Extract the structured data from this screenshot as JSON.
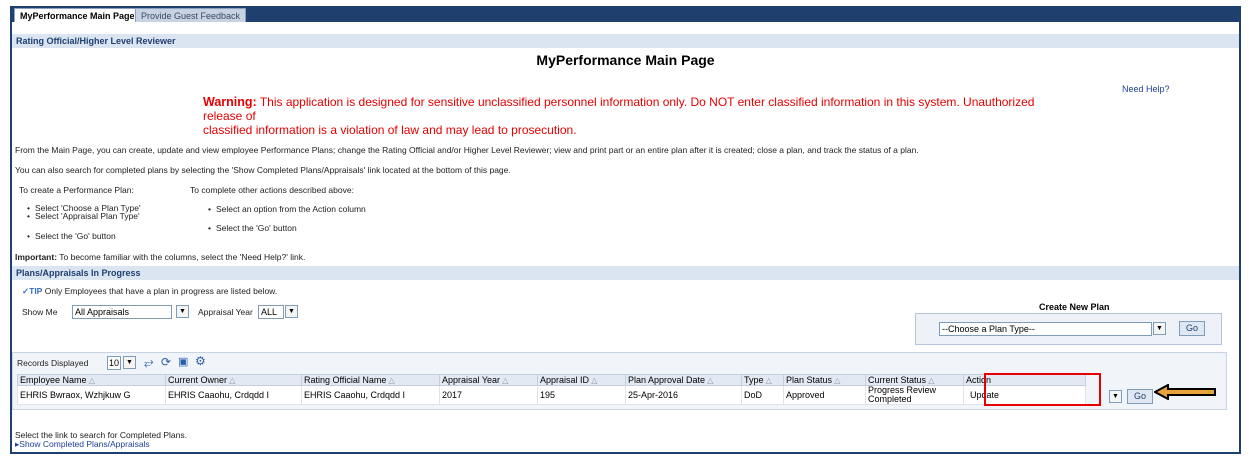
{
  "tabs": [
    {
      "label": "MyPerformance Main Page",
      "active": true
    },
    {
      "label": "Provide Guest Feedback",
      "active": false
    }
  ],
  "role_header": "Rating Official/Higher Level Reviewer",
  "page_title": "MyPerformance Main Page",
  "need_help": "Need Help?",
  "warning": {
    "label": "Warning:",
    "line1": "This application is designed for sensitive unclassified personnel information only. Do NOT enter classified information in this system. Unauthorized release of",
    "line2": "classified information is a violation of law and may lead to prosecution."
  },
  "intro": {
    "p1": "From the Main Page, you can create, update and view employee Performance Plans; change the Rating Official and/or Higher Level Reviewer; view and print part or an entire plan after it is created; close a plan, and track the status of a plan.",
    "p2": "You can also search for completed plans by selecting the 'Show Completed Plans/Appraisals' link located at the bottom of this page.",
    "create_heading": "To create a Performance Plan:",
    "create_steps": [
      "Select 'Choose a Plan Type'",
      "Select 'Appraisal Plan Type'",
      "Select the 'Go' button"
    ],
    "other_heading": "To complete other actions described above:",
    "other_steps": [
      "Select an option from the Action column",
      "Select the 'Go' button"
    ],
    "important_label": "Important:",
    "important_text": "To become familiar with the columns, select the 'Need Help?' link."
  },
  "section_title": "Plans/Appraisals In Progress",
  "tip": {
    "label": "TIP",
    "text": "Only Employees that have a plan in progress are listed below."
  },
  "filters": {
    "show_me_label": "Show Me",
    "show_me_value": "All Appraisals",
    "year_label": "Appraisal Year",
    "year_value": "ALL"
  },
  "create_new_plan": {
    "title": "Create New Plan",
    "select_value": "--Choose a Plan Type--",
    "go_label": "Go"
  },
  "records": {
    "label": "Records Displayed",
    "value": "10"
  },
  "toolbar_icons": [
    "expand-icon",
    "refresh-icon",
    "export-icon",
    "settings-icon"
  ],
  "table": {
    "headers": [
      "Employee Name",
      "Current Owner",
      "Rating Official Name",
      "Appraisal Year",
      "Appraisal ID",
      "Plan Approval Date",
      "Type",
      "Plan Status",
      "Current Status",
      "Action"
    ],
    "rows": [
      {
        "employee_name": "EHRIS Bwraox, Wzhjkuw G",
        "current_owner": "EHRIS Caaohu, Crdqdd I",
        "rating_official": "EHRIS Caaohu, Crdqdd I",
        "appraisal_year": "2017",
        "appraisal_id": "195",
        "approval_date": "25-Apr-2016",
        "type": "DoD",
        "plan_status": "Approved",
        "current_status": "Progress Review Completed",
        "action": "Update",
        "go_label": "Go"
      }
    ]
  },
  "footer": {
    "text": "Select the link to search for Completed Plans.",
    "link": "Show Completed Plans/Appraisals"
  },
  "colors": {
    "header_blue": "#1f3f6e",
    "warning_red": "#e60000",
    "link_blue": "#1f3f9e",
    "highlight_red": "#e60000",
    "arrow_orange": "#e8a23a"
  }
}
